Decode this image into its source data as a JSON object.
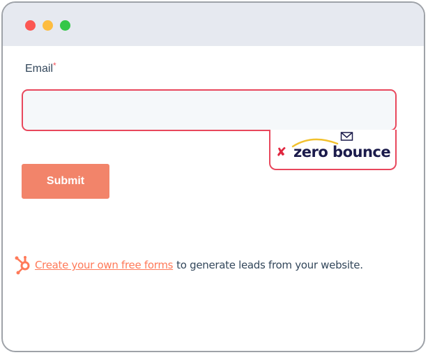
{
  "window": {
    "controls": [
      "close",
      "minimize",
      "maximize"
    ]
  },
  "form": {
    "email_label": "Email",
    "required_marker": "*",
    "email_value": "",
    "email_placeholder": "",
    "submit_label": "Submit"
  },
  "badge": {
    "status_icon": "x-mark-icon",
    "logo_text": "zero bounce",
    "logo_icons": [
      "swoosh-icon",
      "envelope-icon"
    ]
  },
  "footer": {
    "link_text": "Create your own free forms",
    "trailing_text": "to generate leads from your website.",
    "icon": "hubspot-sprocket-icon"
  },
  "colors": {
    "error_border": "#e8475c",
    "submit_bg": "#f2846a",
    "link": "#ff7a59",
    "titlebar": "#e6e9f0",
    "text": "#33475b"
  }
}
